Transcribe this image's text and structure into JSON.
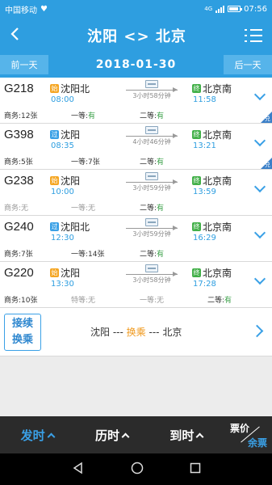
{
  "status": {
    "carrier": "中国移动",
    "time": "07:56",
    "network": "4G"
  },
  "header": {
    "title": "沈阳 <> 北京"
  },
  "datebar": {
    "prev": "前一天",
    "date": "2018-01-30",
    "next": "后一天"
  },
  "trains": [
    {
      "id": "G218",
      "dep_tag": "始",
      "dep_station": "沈阳北",
      "dep_time": "08:00",
      "duration": "3小时58分钟",
      "arr_tag": "终",
      "arr_station": "北京南",
      "arr_time": "11:58",
      "seats": [
        {
          "label": "商务:",
          "value": "12张"
        },
        {
          "label": "一等:",
          "value": "有"
        },
        {
          "label": "二等:",
          "value": "有"
        }
      ],
      "dui": "兑"
    },
    {
      "id": "G398",
      "dep_tag": "过",
      "dep_station": "沈阳",
      "dep_time": "08:35",
      "duration": "4小时46分钟",
      "arr_tag": "终",
      "arr_station": "北京南",
      "arr_time": "13:21",
      "seats": [
        {
          "label": "商务:",
          "value": "5张"
        },
        {
          "label": "一等:",
          "value": "7张"
        },
        {
          "label": "二等:",
          "value": "有"
        }
      ],
      "dui": "兑"
    },
    {
      "id": "G238",
      "dep_tag": "始",
      "dep_station": "沈阳",
      "dep_time": "10:00",
      "duration": "3小时59分钟",
      "arr_tag": "终",
      "arr_station": "北京南",
      "arr_time": "13:59",
      "seats": [
        {
          "label": "商务:",
          "value": "无"
        },
        {
          "label": "一等:",
          "value": "无"
        },
        {
          "label": "二等:",
          "value": "有"
        }
      ]
    },
    {
      "id": "G240",
      "dep_tag": "过",
      "dep_station": "沈阳北",
      "dep_time": "12:30",
      "duration": "3小时59分钟",
      "arr_tag": "终",
      "arr_station": "北京南",
      "arr_time": "16:29",
      "seats": [
        {
          "label": "商务:",
          "value": "7张"
        },
        {
          "label": "一等:",
          "value": "14张"
        },
        {
          "label": "二等:",
          "value": "有"
        }
      ]
    },
    {
      "id": "G220",
      "dep_tag": "始",
      "dep_station": "沈阳",
      "dep_time": "13:30",
      "duration": "3小时58分钟",
      "arr_tag": "终",
      "arr_station": "北京南",
      "arr_time": "17:28",
      "seats": [
        {
          "label": "商务:",
          "value": "10张"
        },
        {
          "label": "特等:",
          "value": "无"
        },
        {
          "label": "一等:",
          "value": "无"
        },
        {
          "label": "二等:",
          "value": "有"
        }
      ]
    }
  ],
  "transfer": {
    "button": "接续换乘",
    "from": "沈阳",
    "mid": "换乘",
    "to": "北京",
    "sep": "---"
  },
  "sortbar": {
    "depart": "发时",
    "duration": "历时",
    "arrive": "到时",
    "price": "票价",
    "remain": "余票"
  },
  "colors": {
    "primary": "#2e9ee0",
    "accent": "#3aa0e6",
    "orange": "#f5a623",
    "green": "#3ca14a"
  }
}
